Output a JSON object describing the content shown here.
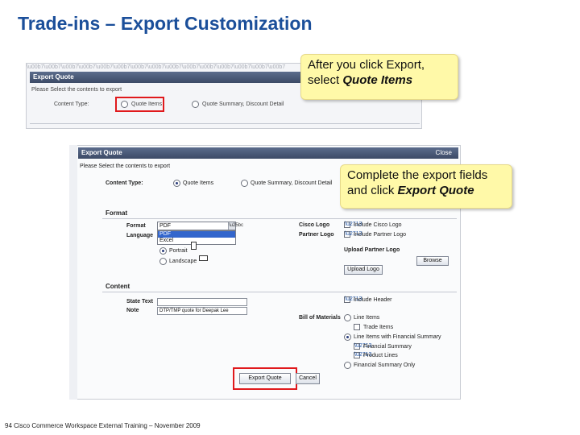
{
  "slide": {
    "title": "Trade-ins – Export Customization",
    "footer": "94 Cisco Commerce Workspace External Training – November 2009"
  },
  "callouts": {
    "first_line1": "After you click Export,",
    "first_line2_prefix": "select ",
    "first_line2_emph": "Quote Items",
    "second_line1": "Complete the export fields",
    "second_line2_prefix": "and click ",
    "second_line2_emph": "Export Quote"
  },
  "screen1": {
    "dialog_title": "Export Quote",
    "instruction": "Please Select the contents to export",
    "content_type_label": "Content Type:",
    "option_quote_items": "Quote Items",
    "option_other": "Quote Summary, Discount Detail"
  },
  "screen2": {
    "dialog_title": "Export Quote",
    "close_label": "Close",
    "instruction": "Please Select the contents to export",
    "content_type_label": "Content Type:",
    "option_quote_items": "Quote Items",
    "option_other": "Quote Summary, Discount Detail",
    "format_section": "Format",
    "format_label": "Format",
    "format_value": "PDF",
    "format_options": [
      "PDF",
      "Excel"
    ],
    "language_label": "Language",
    "orientation_portrait": "Portrait",
    "orientation_landscape": "Landscape",
    "cisco_logo_label": "Cisco Logo",
    "cisco_logo_option": "Include Cisco Logo",
    "partner_logo_label": "Partner Logo",
    "partner_logo_option": "Include Partner Logo",
    "upload_partner_logo_heading": "Upload Partner Logo",
    "browse_button": "Browse",
    "upload_logo_button": "Upload Logo",
    "content_section": "Content",
    "state_text_label": "State Text",
    "note_label": "Note",
    "note_value": "DTP/TMP quote for Deepak Lee",
    "include_header_option": "Include Header",
    "bill_of_materials_label": "Bill of Materials",
    "bom_option_1": "Line Items",
    "bom_trade_items": "Trade Items",
    "bom_option_2": "Line Items with Financial Summary",
    "bom_financial_summary": "Financial Summary",
    "bom_product_lines": "Product Lines",
    "bom_option_3": "Financial Summary Only",
    "export_button": "Export Quote",
    "cancel_button": "Cancel"
  },
  "colors": {
    "title": "#1b4f9a",
    "callout_bg": "#fff9a8",
    "highlight": "#e0191c",
    "dialog_bar": "#3c4a66"
  }
}
